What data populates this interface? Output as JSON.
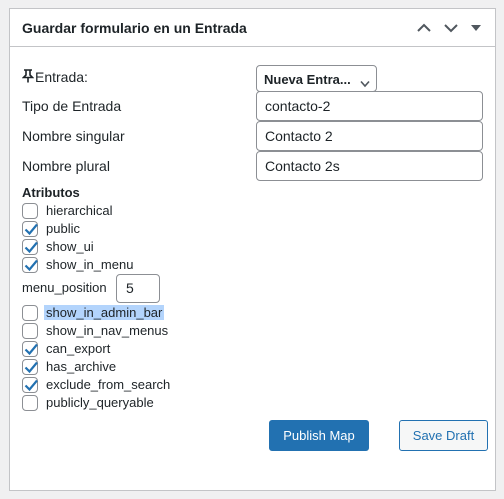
{
  "panel": {
    "title": "Guardar formulario en un Entrada",
    "icons": [
      "chevron-up-icon",
      "chevron-down-icon",
      "triangle-down-icon"
    ]
  },
  "form": {
    "entrada_label": "Entrada:",
    "entrada_select_value": "Nueva Entra...",
    "tipo_label": "Tipo de Entrada",
    "tipo_value": "contacto-2",
    "singular_label": "Nombre singular",
    "singular_value": "Contacto 2",
    "plural_label": "Nombre plural",
    "plural_value": "Contacto 2s"
  },
  "attributes": {
    "label": "Atributos",
    "items_top": [
      {
        "name": "hierarchical",
        "checked": false
      },
      {
        "name": "public",
        "checked": true
      },
      {
        "name": "show_ui",
        "checked": true
      },
      {
        "name": "show_in_menu",
        "checked": true
      }
    ],
    "menu_position_label": "menu_position",
    "menu_position_value": "5",
    "items_bottom": [
      {
        "name": "show_in_admin_bar",
        "checked": false,
        "highlighted": true
      },
      {
        "name": "show_in_nav_menus",
        "checked": false
      },
      {
        "name": "can_export",
        "checked": true
      },
      {
        "name": "has_archive",
        "checked": true
      },
      {
        "name": "exclude_from_search",
        "checked": true
      },
      {
        "name": "publicly_queryable",
        "checked": false
      }
    ]
  },
  "actions": {
    "publish_label": "Publish Map",
    "draft_label": "Save Draft"
  },
  "colors": {
    "accent": "#2271b1",
    "border": "#c3c4c7",
    "selection": "#b3d4fc"
  }
}
